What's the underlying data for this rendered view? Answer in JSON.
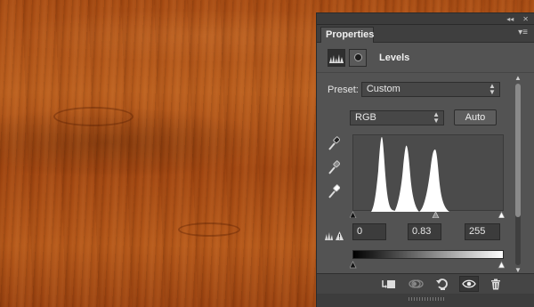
{
  "panel": {
    "tab_label": "Properties",
    "adjustment_title": "Levels",
    "collapse_icon": "double-chevron-left-icon",
    "close_icon": "close-icon",
    "menu_icon": "panel-menu-icon"
  },
  "preset": {
    "label": "Preset:",
    "value": "Custom"
  },
  "channel": {
    "value": "RGB"
  },
  "auto_button": {
    "label": "Auto"
  },
  "inputs": {
    "black": "0",
    "gamma": "0.83",
    "white": "255"
  },
  "bottom_icons": [
    "clip-to-layer-icon",
    "view-previous-state-icon",
    "reset-icon",
    "visibility-eye-icon",
    "trash-icon"
  ],
  "colors": {
    "panel_bg": "#535353",
    "wood": "#a64a12"
  }
}
